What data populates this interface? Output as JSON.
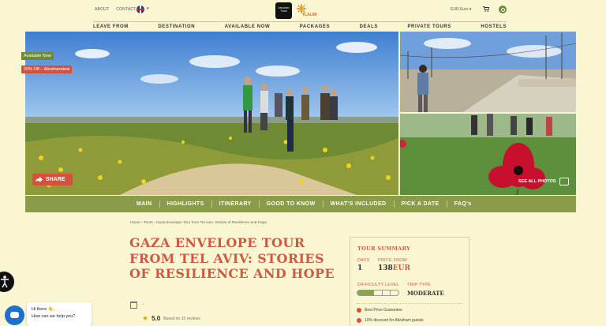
{
  "header": {
    "links": [
      "ABOUT",
      "CONTACT"
    ],
    "logo_text_1": "Abraham Tours",
    "logo_text_2": "TLALIM",
    "currency": "EUR Euro",
    "nav": [
      "LEAVE FROM",
      "DESTINATION",
      "AVAILABLE NOW",
      "PACKAGES",
      "DEALS",
      "PRIVATE TOURS",
      "HOSTELS"
    ]
  },
  "hero": {
    "badge_available": "Available Now",
    "badge_discount": "20% Off – Abrahamdeal",
    "share_label": "SHARE",
    "see_all_label": "SEE ALL PHOTOS"
  },
  "tabs": [
    "MAIN",
    "HIGHLIGHTS",
    "ITINERARY",
    "GOOD TO KNOW",
    "WHAT'S INCLUDED",
    "PICK A DATE",
    "FAQ's"
  ],
  "breadcrumb": "Home › Tours › Gaza Envelope Tour from Tel Aviv: Stories of Resilience and Hope",
  "tour": {
    "title": "GAZA ENVELOPE TOUR FROM TEL AVIV: STORIES OF RESILIENCE AND HOPE",
    "date_placeholder": "-",
    "rating": "5.0",
    "reviews": "Based on 15 reviews"
  },
  "summary": {
    "title": "TOUR SUMMARY",
    "days_label": "DAYS",
    "days_value": "1",
    "price_label": "PRICE FROM",
    "price_value": "138",
    "price_currency": "EUR",
    "difficulty_label": "DIFFICULTY LEVEL",
    "difficulty_level": 0.4,
    "trip_type_label": "TRIP TYPE",
    "trip_type_value": "MODERATE",
    "perks": [
      "Best Price Guarantee",
      "10% discount for Abraham guests"
    ]
  },
  "chat": {
    "line1": "Hi there 👋,",
    "line2": "How can we help you?"
  },
  "colors": {
    "background": "#fbf6d2",
    "accent_green": "#8a9b4a",
    "accent_red": "#cd5a44"
  }
}
